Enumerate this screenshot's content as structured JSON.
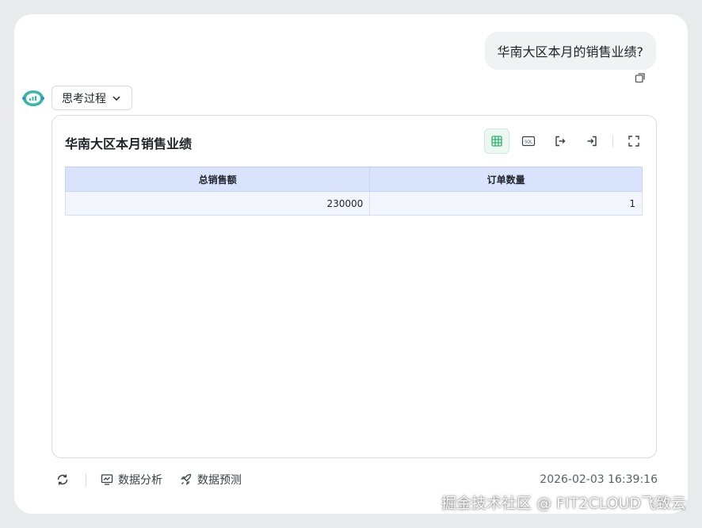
{
  "user_message": {
    "text": "华南大区本月的销售业绩?"
  },
  "thinking": {
    "label": "思考过程"
  },
  "result": {
    "title": "华南大区本月销售业绩",
    "toolbar": {
      "sql_label": "SQL"
    },
    "table": {
      "columns": [
        "总销售额",
        "订单数量"
      ],
      "rows": [
        [
          "230000",
          "1"
        ]
      ]
    }
  },
  "footer": {
    "analysis_label": "数据分析",
    "forecast_label": "数据预测",
    "timestamp": "2026-02-03 16:39:16"
  },
  "watermark": {
    "text": "掘金技术社区 @ FIT2CLOUD飞致云"
  },
  "colors": {
    "accent": "#2db36a",
    "table_header": "#d9e3fb",
    "table_row": "#f3f6fe"
  }
}
